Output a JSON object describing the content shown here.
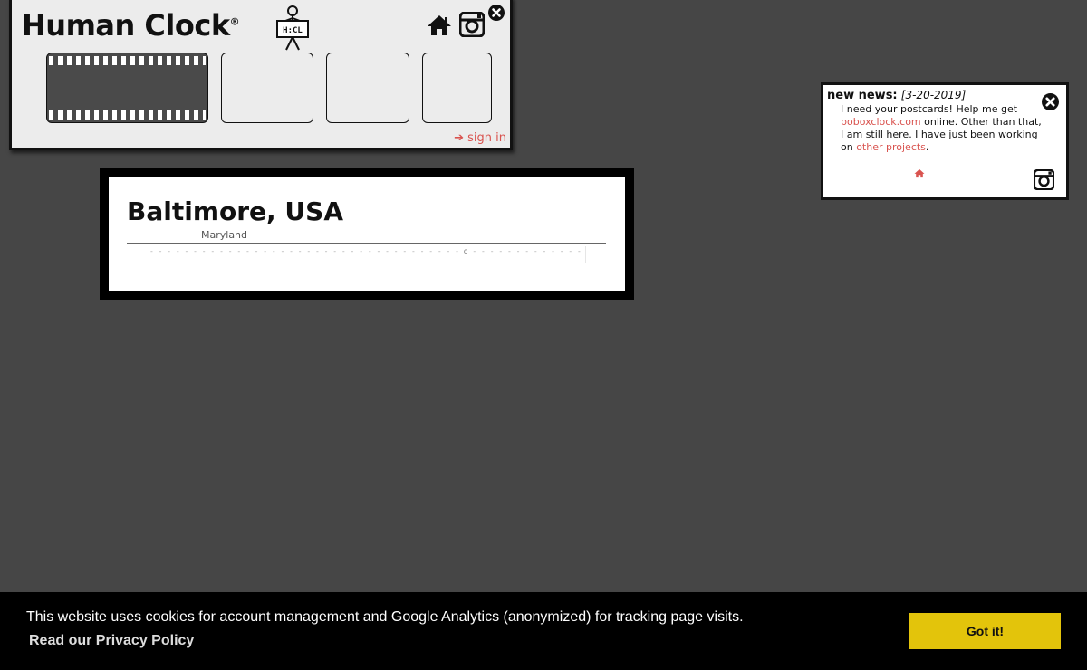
{
  "header": {
    "title": "Human Clock",
    "registered_mark": "®",
    "logo_text": "H:CL",
    "signin_label": "sign in"
  },
  "city": {
    "name": "Baltimore, USA",
    "state": "Maryland",
    "timeline_marker": "o"
  },
  "news": {
    "heading": "new news:",
    "date": "[3-20-2019]",
    "text_1": "I need your postcards! Help me get",
    "link_1": "poboxclock.com",
    "text_2": "online. Other than that, I am still here. I have just been working on",
    "link_2": "other projects",
    "text_3": "."
  },
  "cookie": {
    "message": "This website uses cookies for account management and Google Analytics (anonymized) for tracking page visits.",
    "policy_link": "Read our Privacy Policy",
    "button_label": "Got it!"
  },
  "colors": {
    "background": "#464646",
    "accent_link": "#d9534f",
    "cookie_button": "#e3c40b"
  }
}
